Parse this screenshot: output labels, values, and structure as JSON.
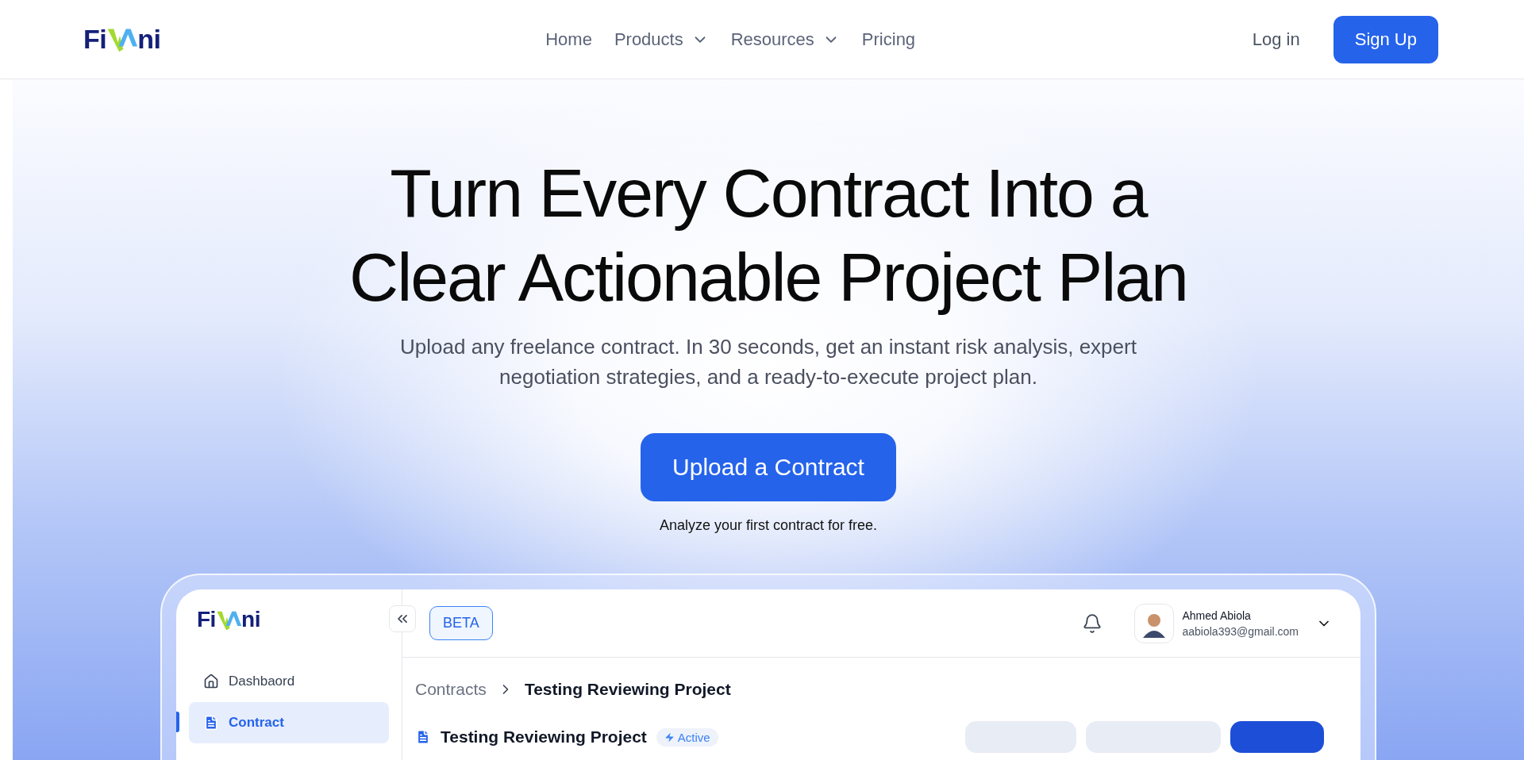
{
  "header": {
    "logo": {
      "left": "Fi",
      "right": "ni"
    },
    "nav": [
      {
        "label": "Home",
        "has_menu": false
      },
      {
        "label": "Products",
        "has_menu": true
      },
      {
        "label": "Resources",
        "has_menu": true
      },
      {
        "label": "Pricing",
        "has_menu": false
      }
    ],
    "login": "Log in",
    "signup": "Sign Up"
  },
  "hero": {
    "title_lines": [
      "Turn Every Contract Into a",
      "Clear Actionable Project Plan"
    ],
    "subtitle_lines": [
      "Upload any freelance contract. In 30 seconds, get an instant risk analysis, expert",
      "negotiation strategies, and a ready-to-execute project plan."
    ],
    "cta": "Upload a Contract",
    "caption": "Analyze your first contract for free."
  },
  "app_preview": {
    "logo": {
      "left": "Fi",
      "right": "ni"
    },
    "badge": "BETA",
    "sidebar": [
      {
        "label": "Dashbaord",
        "kind": "home",
        "selected": false
      },
      {
        "label": "Contract",
        "kind": "document",
        "selected": true
      }
    ],
    "user": {
      "name": "Ahmed Abiola",
      "email": "aabiola393@gmail.com"
    },
    "breadcrumb": {
      "parent": "Contracts",
      "current": "Testing Reviewing Project"
    },
    "project": {
      "title": "Testing Reviewing Project",
      "status": "Active"
    }
  }
}
